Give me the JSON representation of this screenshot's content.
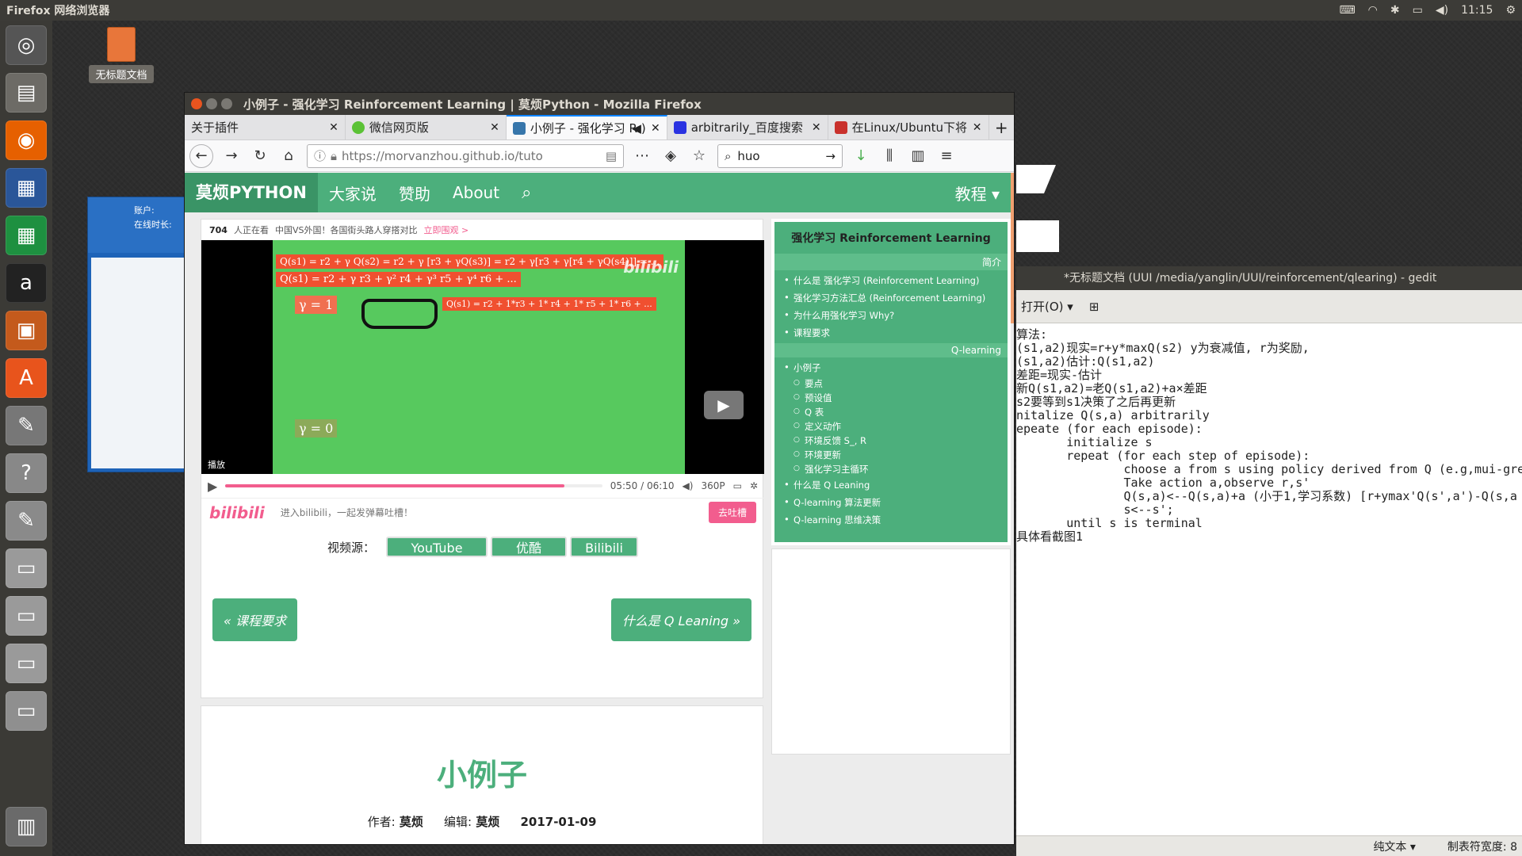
{
  "top_panel": {
    "title": "Firefox 网络浏览器",
    "time": "11:15"
  },
  "desktop": {
    "file_label": "无标题文档"
  },
  "im_window": {
    "account_label": "账户:",
    "online_label": "在线时长:"
  },
  "gedit": {
    "title": "*无标题文档 (UUI /media/yanglin/UUI/reinforcement/qlearing) - gedit",
    "open_label": "打开(O)",
    "lines": [
      "算法:",
      "(s1,a2)现实=r+y*maxQ(s2) y为衰减值, r为奖励,",
      "(s1,a2)估计:Q(s1,a2)",
      "差距=现实-估计",
      "新Q(s1,a2)=老Q(s1,a2)+a×差距",
      "s2要等到s1决策了之后再更新",
      "nitalize Q(s,a) arbitrarily",
      "epeate (for each episode):",
      "       initialize s",
      "       repeat (for each step of episode):",
      "               choose a from s using policy derived from Q (e.g,mui-gre",
      "               Take action a,observe r,s'",
      "               Q(s,a)<--Q(s,a)+a (小于1,学习系数) [r+ymax'Q(s',a')-Q(s,a",
      "               s<--s';",
      "       until s is terminal",
      "具体看截图1"
    ],
    "status_plain": "纯文本",
    "status_tab": "制表符宽度: 8"
  },
  "firefox": {
    "window_title": "小例子 - 强化学习 Reinforcement Learning | 莫烦Python - Mozilla Firefox",
    "tabs": [
      {
        "label": "关于插件",
        "color": "#e3e3e5"
      },
      {
        "label": "微信网页版",
        "color": "#5bc236"
      },
      {
        "label": "小例子 - 强化学习 R",
        "color": "#3776ab"
      },
      {
        "label": "arbitrarily_百度搜索",
        "color": "#2932e1"
      },
      {
        "label": "在Linux/Ubuntu下将",
        "color": "#c9312c"
      }
    ],
    "url": "https://morvanzhou.github.io/tuto",
    "search_value": "huo"
  },
  "site": {
    "brand": "莫烦PYTHON",
    "nav": [
      "大家说",
      "赞助",
      "About"
    ],
    "tutorials": "教程 ▾",
    "notice": {
      "count": "704",
      "watching": "人正在看",
      "text": "中国VS外国！各国街头路人穿搭对比",
      "cta": "立即围观 >"
    },
    "video": {
      "eq1": "Q(s1) = r2 + γ Q(s2) = r2 + γ [r3 + γQ(s3)] = r2 + γ[r3 + γ[r4 + γQ(s4)]] = ...",
      "eq2": "Q(s1) = r2 + γ r3 + γ² r4 + γ³ r5 + γ⁴ r6 + ...",
      "gamma1": "γ = 1",
      "eq3": "Q(s1) = r2 + 1*r3 + 1* r4 + 1* r5 + 1* r6 + ...",
      "gamma0": "γ = 0",
      "watermark": "bilibili",
      "play_label": "播放",
      "progress": 0.9,
      "time": "05:50 / 06:10",
      "quality": "360P"
    },
    "danmaku": {
      "logo": "bilibili",
      "placeholder": "进入bilibili，一起发弹幕吐槽！",
      "button": "去吐槽"
    },
    "source_label": "视频源：",
    "sources": [
      "YouTube",
      "优酷",
      "Bilibili"
    ],
    "prev": "« 课程要求",
    "next": "什么是 Q Leaning »",
    "article": {
      "title": "小例子",
      "author_label": "作者:",
      "author": "莫烦",
      "editor_label": "编辑:",
      "editor": "莫烦",
      "date": "2017-01-09"
    },
    "sidebar": {
      "title": "强化学习 Reinforcement Learning",
      "sec1": "简介",
      "items1": [
        "什么是 强化学习 (Reinforcement Learning)",
        "强化学习方法汇总 (Reinforcement Learning)",
        "为什么用强化学习 Why?",
        "课程要求"
      ],
      "sec2": "Q-learning",
      "item_example": "小例子",
      "subs": [
        "要点",
        "预设值",
        "Q 表",
        "定义动作",
        "环境反馈 S_, R",
        "环境更新",
        "强化学习主循环"
      ],
      "items2": [
        "什么是 Q Leaning",
        "Q-learning 算法更新",
        "Q-learning 思维决策"
      ]
    }
  }
}
